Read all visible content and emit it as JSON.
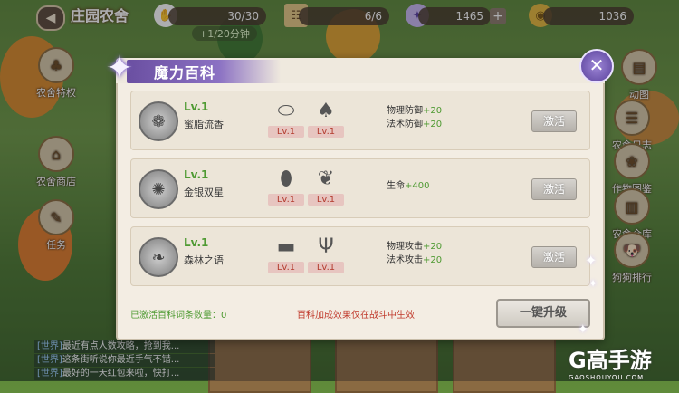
{
  "hud": {
    "farm_name": "庄园农舍",
    "energy": "30/30",
    "energy_timer": "+1/20分钟",
    "scroll": "6/6",
    "gems": "1465",
    "gold": "1036"
  },
  "side_left": [
    {
      "label": "农舍特权",
      "icon": "clover-icon"
    },
    {
      "label": "农舍商店",
      "icon": "shop-icon"
    },
    {
      "label": "任务",
      "icon": "task-icon"
    }
  ],
  "side_right": [
    {
      "label": "动图",
      "icon": "pages-icon"
    },
    {
      "label": "农舍日志",
      "icon": "log-icon"
    },
    {
      "label": "作物图鉴",
      "icon": "crop-icon"
    },
    {
      "label": "农舍仓库",
      "icon": "warehouse-icon"
    },
    {
      "label": "狗狗排行",
      "icon": "dog-icon"
    }
  ],
  "chat": [
    {
      "tag": "[世界]",
      "text": "最近有点人数攻略，抢到我..."
    },
    {
      "tag": "[世界]",
      "text": "这条街听说你最近手气不错..."
    },
    {
      "tag": "[世界]",
      "text": "最好的一天红包来啦，快打..."
    }
  ],
  "modal": {
    "title": "魔力百科",
    "rows": [
      {
        "level": "Lv.1",
        "name": "蜜脂流香",
        "materials": [
          {
            "level": "Lv.1",
            "icon": "stone-icon"
          },
          {
            "level": "Lv.1",
            "icon": "mushroom-icon"
          }
        ],
        "attrs": [
          {
            "label": "物理防御",
            "value": "+20"
          },
          {
            "label": "法术防御",
            "value": "+20"
          }
        ],
        "button": "激活"
      },
      {
        "level": "Lv.1",
        "name": "金银双星",
        "materials": [
          {
            "level": "Lv.1",
            "icon": "cocoon-icon"
          },
          {
            "level": "Lv.1",
            "icon": "feather-icon"
          }
        ],
        "attrs": [
          {
            "label": "生命",
            "value": "+400"
          }
        ],
        "button": "激活"
      },
      {
        "level": "Lv.1",
        "name": "森林之语",
        "materials": [
          {
            "level": "Lv.1",
            "icon": "log-wood-icon"
          },
          {
            "level": "Lv.1",
            "icon": "antler-icon"
          }
        ],
        "attrs": [
          {
            "label": "物理攻击",
            "value": "+20"
          },
          {
            "label": "法术攻击",
            "value": "+20"
          }
        ],
        "button": "激活"
      }
    ],
    "activated_count_label": "已激活百科词条数量：0",
    "battle_note": "百科加成效果仅在战斗中生效",
    "upgrade_button": "一键升级"
  },
  "watermark": {
    "logo": "G高手游",
    "url": "GAOSHOUYOU.COM"
  },
  "colors": {
    "accent_purple": "#6a4fa1",
    "green_text": "#4e9a32",
    "red_text": "#c0392b"
  }
}
